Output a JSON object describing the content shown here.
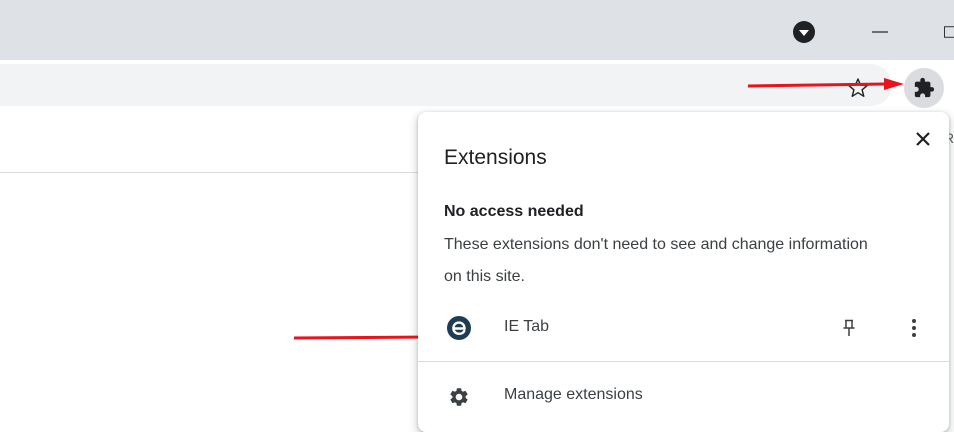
{
  "titlebar": {
    "icons": [
      "profile-icon",
      "minimize-icon",
      "restore-icon"
    ]
  },
  "toolbar": {
    "icons": [
      "star-icon",
      "puzzle-icon"
    ]
  },
  "page": {
    "edge_text": "R"
  },
  "extensions_popup": {
    "title": "Extensions",
    "close_icon": "close-icon",
    "section_heading": "No access needed",
    "section_description": "These extensions don't need to see and change information on this site.",
    "extensions": [
      {
        "name": "IE Tab",
        "icon": "ie-tab-icon",
        "pin_icon": "pin-icon",
        "menu_icon": "more-vert-icon"
      }
    ],
    "manage_label": "Manage extensions",
    "manage_icon": "gear-icon"
  },
  "colors": {
    "titlebar_bg": "#dee1e6",
    "omnibox_bg": "#f1f3f4",
    "annotation_arrow": "#e8141c",
    "text_primary": "#202124",
    "text_secondary": "#3c4043"
  }
}
